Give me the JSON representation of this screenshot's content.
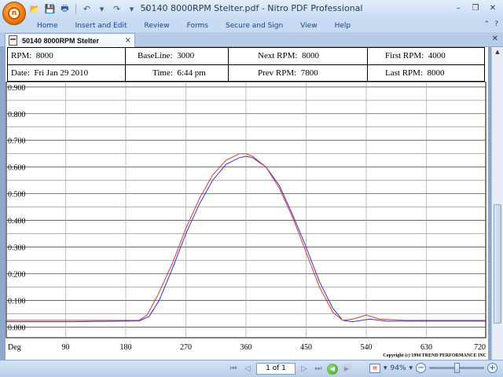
{
  "window": {
    "title": "50140 8000RPM Stelter.pdf - Nitro PDF Professional",
    "min_icon": "minimize-icon",
    "restore_icon": "restore-icon",
    "close_icon": "close-icon"
  },
  "quick_access": [
    "open-folder-icon",
    "save-icon",
    "print-icon",
    "undo-icon",
    "redo-icon",
    "customize-icon"
  ],
  "ribbon": {
    "tabs": [
      "Home",
      "Insert and Edit",
      "Review",
      "Forms",
      "Secure and Sign",
      "View",
      "Help"
    ]
  },
  "doc_tab": {
    "label": "50140 8000RPM Stelter",
    "close": "×"
  },
  "info": {
    "rpm_label": "RPM:",
    "rpm": "8000",
    "baseline_label": "BaseLine:",
    "baseline": "3000",
    "next_rpm_label": "Next RPM:",
    "next_rpm": "8000",
    "first_rpm_label": "First RPM:",
    "first_rpm": "4000",
    "date_label": "Date:",
    "date": "Fri Jan 29 2010",
    "time_label": "Time:",
    "time": "6:44 pm",
    "prev_rpm_label": "Prev RPM:",
    "prev_rpm": "7800",
    "last_rpm_label": "Last RPM:",
    "last_rpm": "8000"
  },
  "chart_data": {
    "type": "line",
    "xlabel": "Deg",
    "x_ticks": [
      90,
      180,
      270,
      360,
      450,
      540,
      630,
      720
    ],
    "y_ticks": [
      "0.900",
      "0.800",
      "0.700",
      "0.600",
      "0.500",
      "0.400",
      "0.300",
      "0.200",
      "0.100",
      "0.000"
    ],
    "xlim": [
      0,
      720
    ],
    "ylim": [
      -0.04,
      0.92
    ],
    "grid": true,
    "copyright": "Copyright (c) 1994 TREND PERFORMANCE INC",
    "series": [
      {
        "color": "#3333cc",
        "points": [
          [
            0,
            0.02
          ],
          [
            100,
            0.02
          ],
          [
            200,
            0.023
          ],
          [
            215,
            0.04
          ],
          [
            230,
            0.1
          ],
          [
            250,
            0.22
          ],
          [
            270,
            0.35
          ],
          [
            290,
            0.46
          ],
          [
            310,
            0.55
          ],
          [
            330,
            0.61
          ],
          [
            350,
            0.635
          ],
          [
            360,
            0.64
          ],
          [
            370,
            0.635
          ],
          [
            390,
            0.6
          ],
          [
            410,
            0.53
          ],
          [
            430,
            0.42
          ],
          [
            450,
            0.3
          ],
          [
            470,
            0.17
          ],
          [
            490,
            0.07
          ],
          [
            505,
            0.025
          ],
          [
            520,
            0.02
          ],
          [
            545,
            0.03
          ],
          [
            570,
            0.022
          ],
          [
            600,
            0.022
          ],
          [
            720,
            0.022
          ]
        ]
      },
      {
        "color": "#dd3333",
        "points": [
          [
            0,
            0.025
          ],
          [
            100,
            0.025
          ],
          [
            200,
            0.025
          ],
          [
            212,
            0.045
          ],
          [
            228,
            0.12
          ],
          [
            250,
            0.24
          ],
          [
            270,
            0.37
          ],
          [
            290,
            0.48
          ],
          [
            310,
            0.57
          ],
          [
            330,
            0.625
          ],
          [
            350,
            0.65
          ],
          [
            360,
            0.65
          ],
          [
            370,
            0.64
          ],
          [
            390,
            0.6
          ],
          [
            410,
            0.52
          ],
          [
            430,
            0.41
          ],
          [
            450,
            0.28
          ],
          [
            470,
            0.15
          ],
          [
            490,
            0.055
          ],
          [
            505,
            0.025
          ],
          [
            520,
            0.03
          ],
          [
            540,
            0.045
          ],
          [
            560,
            0.03
          ],
          [
            600,
            0.025
          ],
          [
            720,
            0.025
          ]
        ]
      }
    ]
  },
  "status": {
    "page_display": "1 of 1",
    "zoom": "94%",
    "first_icon": "first-page-icon",
    "prev_icon": "prev-page-icon",
    "next_icon": "next-page-icon",
    "last_icon": "last-page-icon"
  }
}
